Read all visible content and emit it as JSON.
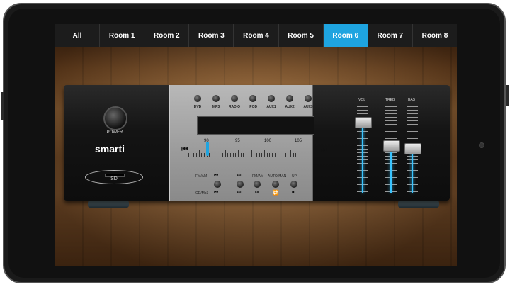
{
  "tabs": [
    "All",
    "Room 1",
    "Room 2",
    "Room 3",
    "Room 4",
    "Room 5",
    "Room 6",
    "Room 7",
    "Room 8"
  ],
  "active_tab": "Room 6",
  "amp": {
    "power_label": "POWER",
    "brand": "smarti",
    "sd_label": "SD",
    "sources": [
      "DVD",
      "MP3",
      "RADIO",
      "IPOD",
      "AUX1",
      "AUX2",
      "AUX3"
    ],
    "frequencies": [
      "90",
      "95",
      "100",
      "105"
    ],
    "seek_prev": "⏮",
    "seek_next": "⏭",
    "controls": {
      "fmam": "FM/AM",
      "cdmp3": "CD/Mp3",
      "fmam2": "FM/AM",
      "automan": "AUTO/MAN",
      "up": "UP"
    },
    "mixer": {
      "vol_label": "VOL",
      "treb_label": "TREB",
      "bas_label": "BAS",
      "vol_level": 0.82,
      "treb_level": 0.55,
      "bas_level": 0.52
    },
    "tuner_position": 0.18
  },
  "colors": {
    "accent": "#1ea4e0",
    "glow": "#39c4ff"
  }
}
